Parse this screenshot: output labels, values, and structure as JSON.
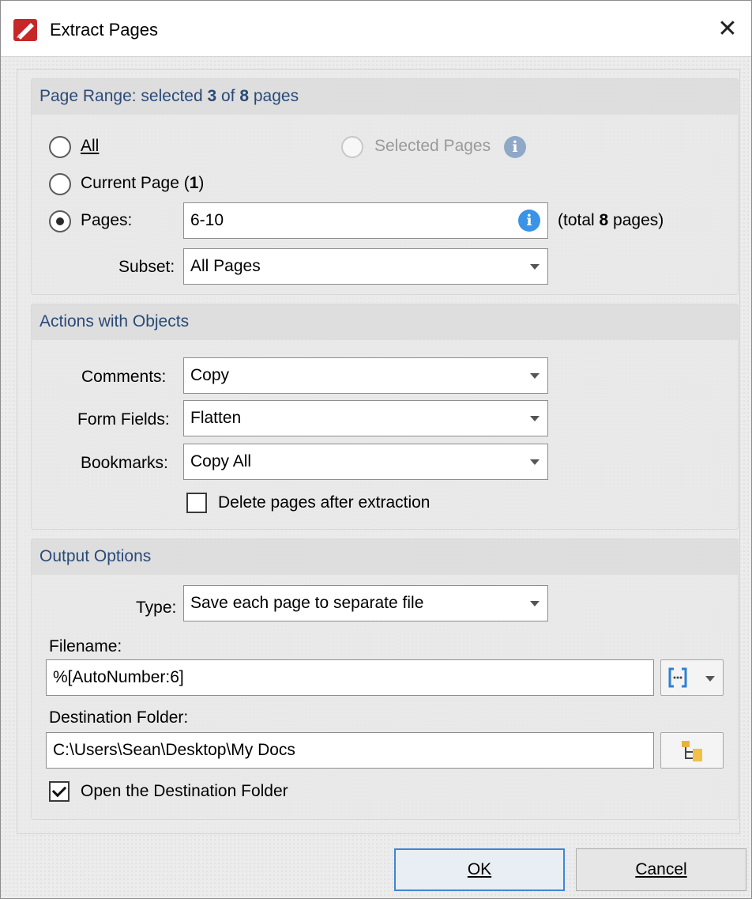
{
  "window": {
    "title": "Extract Pages",
    "close_glyph": "✕",
    "app_icon": "pdf-xchange-icon"
  },
  "page_range": {
    "title_prefix": "Page Range: selected ",
    "selected_count": "3",
    "title_mid": " of ",
    "total_count": "8",
    "title_suffix": " pages",
    "all_label": "All",
    "selected_pages_label": "Selected Pages",
    "current_page_label": "Current Page (",
    "current_page_num": "1",
    "current_page_close": ")",
    "pages_label": "Pages:",
    "pages_value": "6-10",
    "total_prefix": "(total ",
    "total_num": "8",
    "total_suffix": " pages)",
    "subset_label": "Subset:",
    "subset_value": "All Pages",
    "selected_option": "pages"
  },
  "actions": {
    "title": "Actions with Objects",
    "comments_label": "Comments:",
    "comments_value": "Copy",
    "form_fields_label": "Form Fields:",
    "form_fields_value": "Flatten",
    "bookmarks_label": "Bookmarks:",
    "bookmarks_value": "Copy All",
    "delete_pages_label": "Delete pages after extraction",
    "delete_pages_checked": false
  },
  "output": {
    "title": "Output Options",
    "type_label": "Type:",
    "type_value": "Save each page to separate file",
    "filename_label": "Filename:",
    "filename_value": "%[AutoNumber:6]",
    "destination_label": "Destination Folder:",
    "destination_value": "C:\\Users\\Sean\\Desktop\\My Docs",
    "open_folder_label": "Open the Destination Folder",
    "open_folder_checked": true
  },
  "buttons": {
    "ok": "OK",
    "cancel": "Cancel"
  },
  "colors": {
    "accent": "#3b93e6",
    "group_title": "#2a4a78",
    "default_button_border": "#3f86d6"
  }
}
